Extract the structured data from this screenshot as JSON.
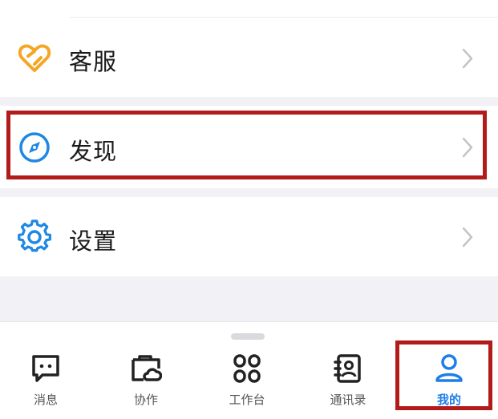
{
  "menu": {
    "items": [
      {
        "id": "customer-service",
        "label": "客服",
        "icon": "heart-link-icon",
        "color": "#f5a623"
      },
      {
        "id": "discover",
        "label": "发现",
        "icon": "compass-icon",
        "color": "#1e88e5"
      },
      {
        "id": "settings",
        "label": "设置",
        "icon": "gear-icon",
        "color": "#1e88e5"
      }
    ]
  },
  "tabbar": {
    "tabs": [
      {
        "id": "messages",
        "label": "消息",
        "icon": "chat-bubble-icon"
      },
      {
        "id": "collab",
        "label": "协作",
        "icon": "folder-cloud-icon"
      },
      {
        "id": "workbench",
        "label": "工作台",
        "icon": "grid-icon"
      },
      {
        "id": "contacts",
        "label": "通讯录",
        "icon": "contact-book-icon"
      },
      {
        "id": "me",
        "label": "我的",
        "icon": "person-icon",
        "active": true
      }
    ],
    "active_color": "#1e7ee8"
  },
  "highlight_color": "#b31b1b"
}
